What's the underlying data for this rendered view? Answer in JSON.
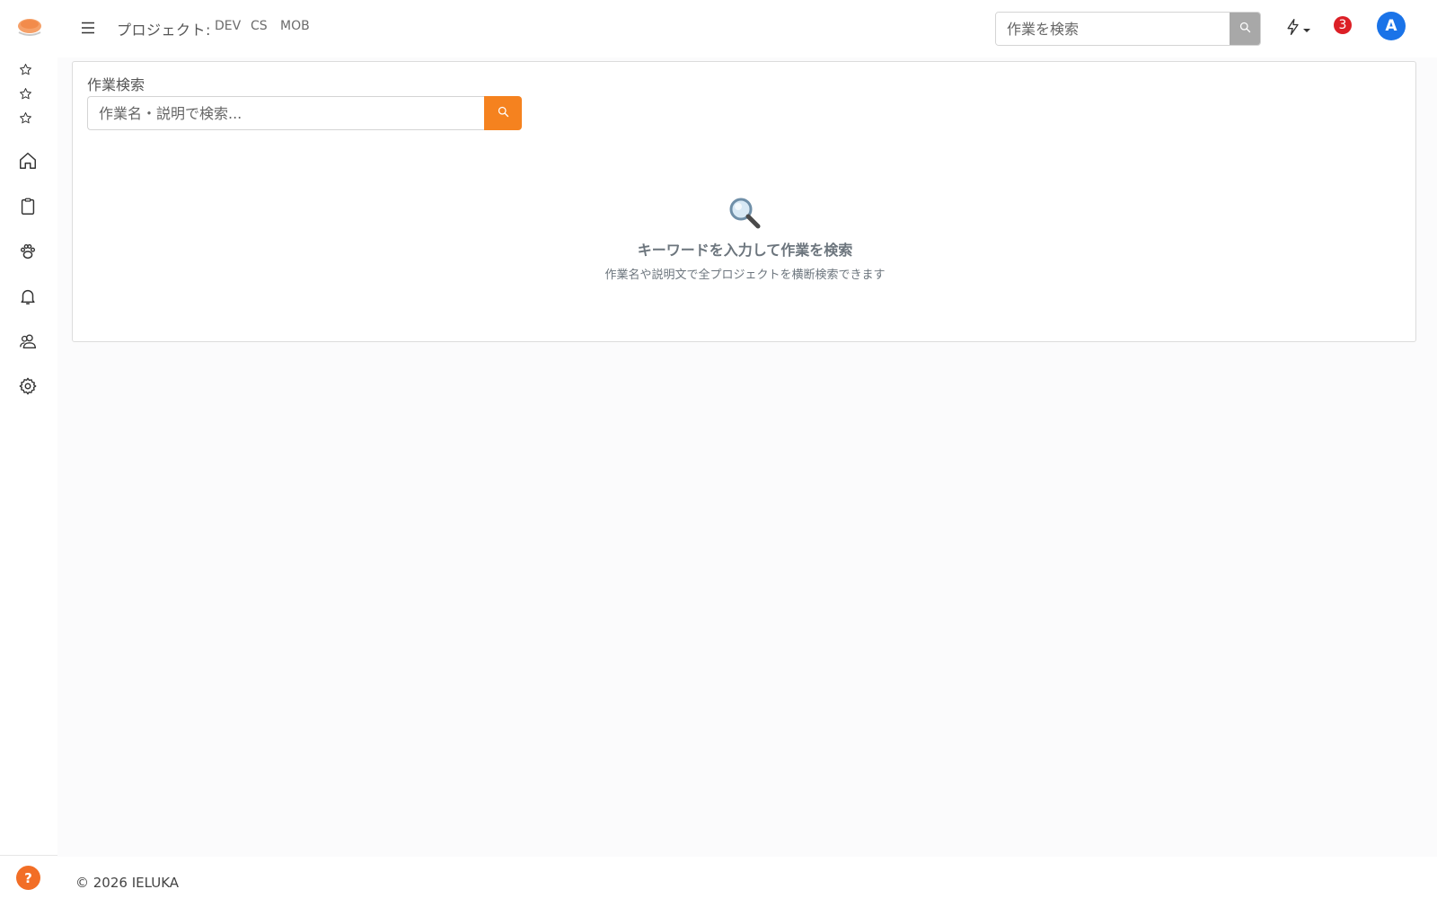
{
  "app": {
    "accent_color": "#f5821f",
    "logo_icon": "bowl-logo-icon"
  },
  "rail": {
    "favorites": [
      "star-icon",
      "star-icon",
      "star-icon"
    ],
    "items": [
      {
        "icon": "home-icon"
      },
      {
        "icon": "clipboard-icon"
      },
      {
        "icon": "paw-icon"
      },
      {
        "icon": "bell-icon"
      },
      {
        "icon": "users-icon"
      },
      {
        "icon": "gear-icon"
      }
    ],
    "help_label": "?"
  },
  "header": {
    "menu_icon": "hamburger-icon",
    "project_label": "プロジェクト:",
    "projects": [
      "DEV",
      "CS",
      "MOB"
    ],
    "search_placeholder": "作業を検索",
    "search_icon": "search-icon",
    "bolt_icon": "lightning-icon",
    "notification_count": "3",
    "avatar_initial": "A"
  },
  "main": {
    "card_title": "作業検索",
    "search_placeholder": "作業名・説明で検索...",
    "empty_title": "キーワードを入力して作業を検索",
    "empty_subtitle": "作業名や説明文で全プロジェクトを横断検索できます",
    "empty_icon": "magnifier-emoji-icon"
  },
  "footer": {
    "copyright": "© 2026 IELUKA"
  }
}
